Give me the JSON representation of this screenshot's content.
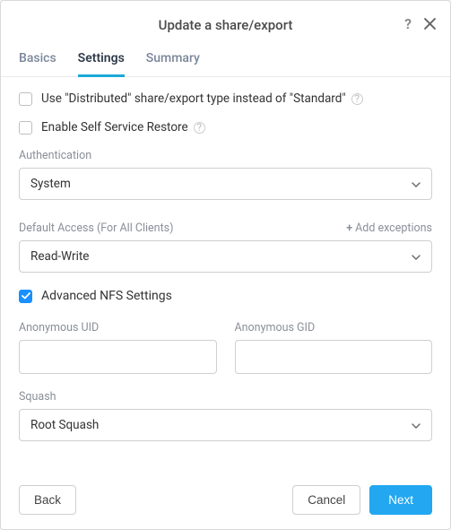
{
  "header": {
    "title": "Update a share/export"
  },
  "tabs": {
    "basics": "Basics",
    "settings": "Settings",
    "summary": "Summary"
  },
  "checkboxes": {
    "distributed_label": "Use \"Distributed\" share/export type instead of \"Standard\"",
    "self_service_label": "Enable Self Service Restore",
    "advanced_label": "Advanced NFS Settings"
  },
  "fields": {
    "auth_label": "Authentication",
    "auth_value": "System",
    "default_access_label": "Default Access (For All Clients)",
    "default_access_value": "Read-Write",
    "add_exceptions": "Add exceptions",
    "anon_uid_label": "Anonymous UID",
    "anon_uid_value": "",
    "anon_gid_label": "Anonymous GID",
    "anon_gid_value": "",
    "squash_label": "Squash",
    "squash_value": "Root Squash"
  },
  "footer": {
    "back": "Back",
    "cancel": "Cancel",
    "next": "Next"
  }
}
